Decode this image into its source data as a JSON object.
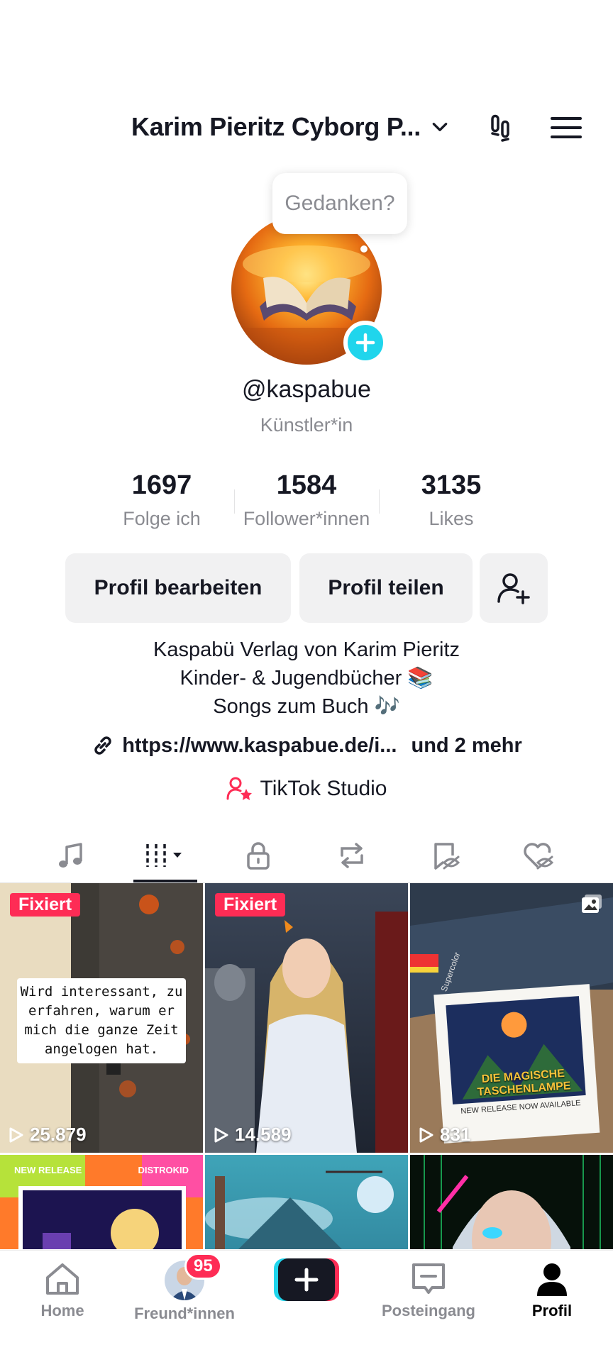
{
  "header": {
    "account_name": "Karim Pieritz Cyborg P...",
    "icons": [
      "chevron-down-icon",
      "footprints-icon",
      "menu-icon"
    ]
  },
  "profile": {
    "bubble_text": "Gedanken?",
    "username": "@kaspabue",
    "category": "Künstler*in"
  },
  "stats": [
    {
      "value": "1697",
      "label": "Folge ich"
    },
    {
      "value": "1584",
      "label": "Follower*innen"
    },
    {
      "value": "3135",
      "label": "Likes"
    }
  ],
  "buttons": {
    "edit": "Profil bearbeiten",
    "share": "Profil teilen"
  },
  "bio": {
    "line1": "Kaspabü Verlag von Karim Pieritz",
    "line2": "Kinder- & Jugendbücher 📚",
    "line3": "Songs zum Buch 🎶"
  },
  "link": {
    "url": "https://www.kaspabue.de/i...",
    "more": "und 2 mehr"
  },
  "studio": {
    "label": "TikTok Studio"
  },
  "tabs": [
    "music-icon",
    "videos-grid-icon",
    "lock-icon",
    "repost-icon",
    "favorites-hidden-icon",
    "liked-hidden-icon"
  ],
  "videos": [
    {
      "pinned_label": "Fixiert",
      "views": "25.879",
      "caption": "Wird interessant, zu erfahren, warum er mich die ganze Zeit angelogen hat."
    },
    {
      "pinned_label": "Fixiert",
      "views": "14.589"
    },
    {
      "views": "831",
      "card_title_line1": "DIE MAGISCHE",
      "card_title_line2": "TASCHENLAMPE",
      "card_sub": "NEW RELEASE NOW AVAILABLE",
      "brand": "Supercolor"
    },
    {
      "tag_left": "NEW RELEASE",
      "tag_right": "DISTROKID"
    },
    {},
    {}
  ],
  "bottom_nav": {
    "home": "Home",
    "friends": "Freund*innen",
    "friends_badge": "95",
    "inbox": "Posteingang",
    "profile": "Profil"
  },
  "colors": {
    "accent_red": "#fe2c55",
    "accent_cyan": "#20d5ec",
    "text_primary": "#161823",
    "text_secondary": "#8a8b91",
    "button_bg": "#f1f1f2"
  }
}
